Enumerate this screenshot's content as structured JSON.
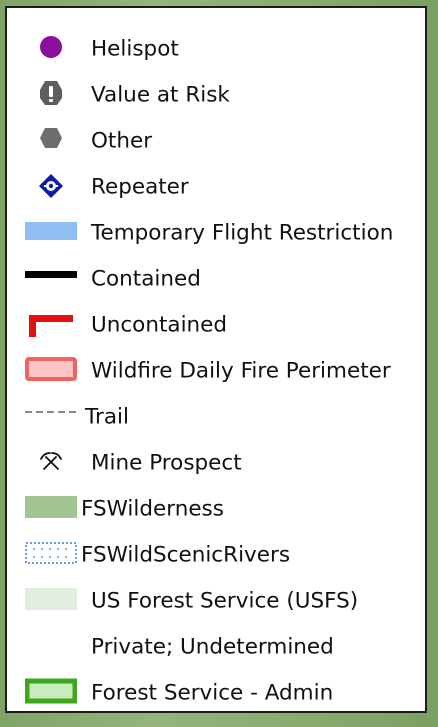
{
  "legend": {
    "items": [
      {
        "label": "Helispot",
        "icon": "helispot-icon",
        "color": "#8a0f9c"
      },
      {
        "label": "Value at Risk",
        "icon": "exclamation-icon",
        "color": "#5e5e5e"
      },
      {
        "label": "Other",
        "icon": "hexagon-icon",
        "color": "#6e6e6e"
      },
      {
        "label": "Repeater",
        "icon": "repeater-icon",
        "color": "#0d1da3"
      },
      {
        "label": "Temporary Flight Restriction",
        "icon": "tfr-swatch-icon",
        "color": "#8fbef5"
      },
      {
        "label": "Contained",
        "icon": "contained-line-icon",
        "color": "#000000"
      },
      {
        "label": "Uncontained",
        "icon": "uncontained-line-icon",
        "color": "#e31010"
      },
      {
        "label": "Wildfire Daily Fire Perimeter",
        "icon": "perimeter-swatch-icon",
        "color": "#f06363"
      },
      {
        "label": "Trail",
        "icon": "dashed-line-icon",
        "color": "#8a8a8a"
      },
      {
        "label": "Mine Prospect",
        "icon": "pick-axes-icon",
        "color": "#111111"
      },
      {
        "label": "FSWilderness",
        "icon": "wilderness-swatch-icon",
        "color": "#a2c392"
      },
      {
        "label": "FSWildScenicRivers",
        "icon": "scenic-rivers-swatch-icon",
        "color": "#3f7fc9"
      },
      {
        "label": "US Forest Service (USFS)",
        "icon": "usfs-swatch-icon",
        "color": "#dfeedd"
      },
      {
        "label": "Private; Undetermined",
        "icon": "",
        "color": "#ffffff"
      },
      {
        "label": "Forest Service - Admin",
        "icon": "admin-swatch-icon",
        "color": "#3ea81c"
      }
    ]
  }
}
